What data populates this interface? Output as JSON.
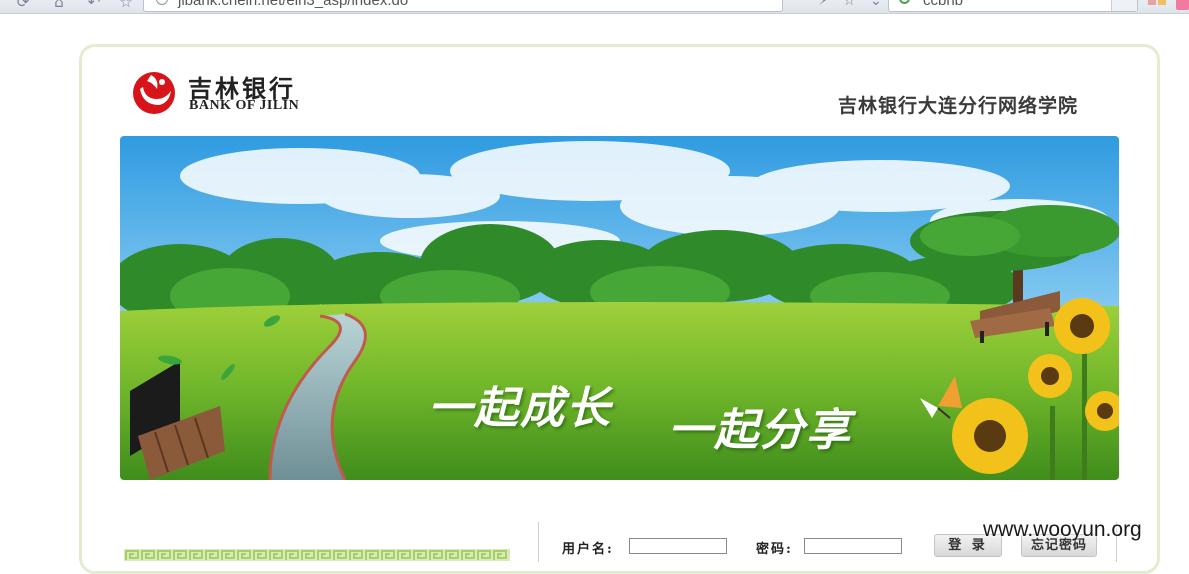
{
  "browser": {
    "url": "jibank.chein.net/eln3_asp/index.do",
    "search_value": "ccbnb"
  },
  "header": {
    "logo_cn": "吉林银行",
    "logo_en": "BANK OF JILIN",
    "site_title": "吉林银行大连分行网络学院"
  },
  "banner": {
    "slogan_1": "一起成长",
    "slogan_2": "一起分享"
  },
  "login": {
    "username_label": "用户名:",
    "username_value": "",
    "password_label": "密码:",
    "password_value": "",
    "login_button": "登 录",
    "forgot_button": "忘记密码"
  },
  "watermark": "www.wooyun.org",
  "colors": {
    "brand_red": "#d7141a",
    "frame_border": "#e4ecd0",
    "fret_green": "#a6cf6a"
  }
}
